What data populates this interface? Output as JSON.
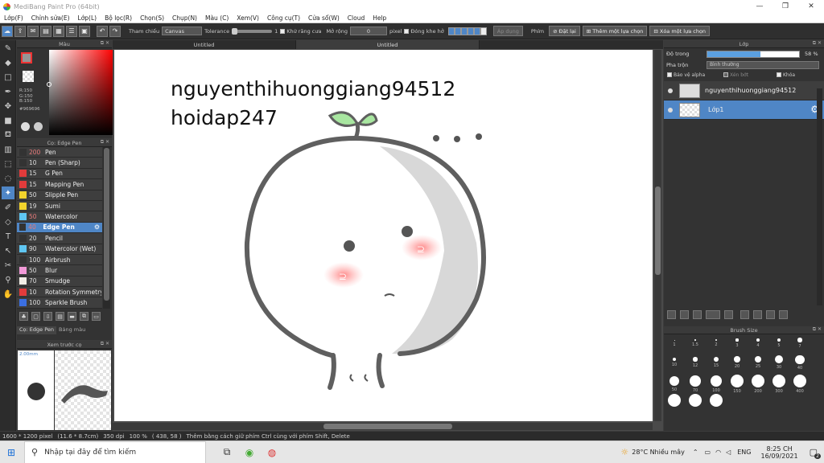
{
  "window": {
    "title": "MediBang Paint Pro (64bit)",
    "minimize": "—",
    "maximize": "❐",
    "close": "✕"
  },
  "menu": [
    "Lớp(F)",
    "Chỉnh sửa(E)",
    "Lớp(L)",
    "Bộ lọc(R)",
    "Chọn(S)",
    "Chụp(N)",
    "Màu (C)",
    "Xem(V)",
    "Công cụ(T)",
    "Cửa sổ(W)",
    "Cloud",
    "Help"
  ],
  "toolbar": {
    "ref_label": "Tham chiếu",
    "ref_value": "Canvas",
    "tolerance_label": "Tolerance",
    "tolerance_value": "1",
    "antialias_label": "Khử răng cưa",
    "expand_label": "Mở rộng",
    "expand_value": "0",
    "expand_unit": "pixel",
    "close_gap_label": "Đóng khe hở",
    "apply_label": "Áp dụng",
    "keys_label": "Phím",
    "reset_label": "Đặt lại",
    "add_sel_label": "Thêm một lựa chọn",
    "remove_sel_label": "Xóa một lựa chọn"
  },
  "color_panel": {
    "title": "Màu",
    "r": "R:150",
    "g": "G:150",
    "b": "B:150",
    "hex": "#969696"
  },
  "brush_panel": {
    "title": "Cọ: Edge Pen",
    "items": [
      {
        "size": "200",
        "name": "Pen",
        "color": "#333333"
      },
      {
        "size": "10",
        "name": "Pen (Sharp)",
        "color": "#333333"
      },
      {
        "size": "15",
        "name": "G Pen",
        "color": "#e23b3b"
      },
      {
        "size": "15",
        "name": "Mapping Pen",
        "color": "#e23b3b"
      },
      {
        "size": "50",
        "name": "Slipple Pen",
        "color": "#f2d32c"
      },
      {
        "size": "19",
        "name": "Sumi",
        "color": "#f2d32c"
      },
      {
        "size": "50",
        "name": "Watercolor",
        "color": "#5fc6f2"
      },
      {
        "size": "40",
        "name": "Edge Pen",
        "color": "#333333"
      },
      {
        "size": "20",
        "name": "Pencil",
        "color": "#333333"
      },
      {
        "size": "90",
        "name": "Watercolor (Wet)",
        "color": "#5fc6f2"
      },
      {
        "size": "100",
        "name": "Airbrush",
        "color": "#333333"
      },
      {
        "size": "50",
        "name": "Blur",
        "color": "#f29ad8"
      },
      {
        "size": "70",
        "name": "Smudge",
        "color": "#f2eee6"
      },
      {
        "size": "10",
        "name": "Rotation Symmetry",
        "color": "#e23b3b"
      },
      {
        "size": "100",
        "name": "Sparkle Brush",
        "color": "#3b6fe2"
      }
    ],
    "tab1": "Cọ: Edge Pen",
    "tab2": "Bảng màu"
  },
  "preview_panel": {
    "title": "Xem trước cọ",
    "size": "2.00mm"
  },
  "canvas": {
    "tab1": "Untitled",
    "tab2": "Untitled",
    "text_line1": "nguyenthihuonggiang94512",
    "text_line2": "hoidap247"
  },
  "layer_panel": {
    "title": "Lớp",
    "opacity_label": "Độ trong",
    "opacity_value": "58 %",
    "opacity": 0.58,
    "blend_label": "Pha trộn",
    "blend_value": "Bình thường",
    "protect_alpha": "Bảo vệ alpha",
    "clip": "Xén bớt",
    "lock": "Khóa",
    "layers": [
      {
        "name": "nguyenthihuonggiang94512"
      },
      {
        "name": "Lớp1"
      }
    ]
  },
  "brush_size_panel": {
    "title": "Brush Size",
    "sizes": [
      "1",
      "1.5",
      "2",
      "3",
      "4",
      "5",
      "7",
      "10",
      "12",
      "15",
      "20",
      "25",
      "30",
      "40",
      "50",
      "70",
      "100",
      "150",
      "200",
      "300",
      "400",
      "",
      "",
      ""
    ]
  },
  "status": {
    "dims": "1600 * 1200 pixel",
    "physical": "(11.6 * 8.7cm)",
    "dpi": "350 dpi",
    "zoom": "100 %",
    "coords": "( 438, 58 )",
    "hint": "Thêm bằng cách giữ phím Ctrl cùng với phím Shift, Delete"
  },
  "taskbar": {
    "search_placeholder": "Nhập tại đây để tìm kiếm",
    "weather": "28°C  Nhiều mây",
    "lang": "ENG",
    "time": "8:25 CH",
    "date": "16/09/2021",
    "notif": "2"
  }
}
